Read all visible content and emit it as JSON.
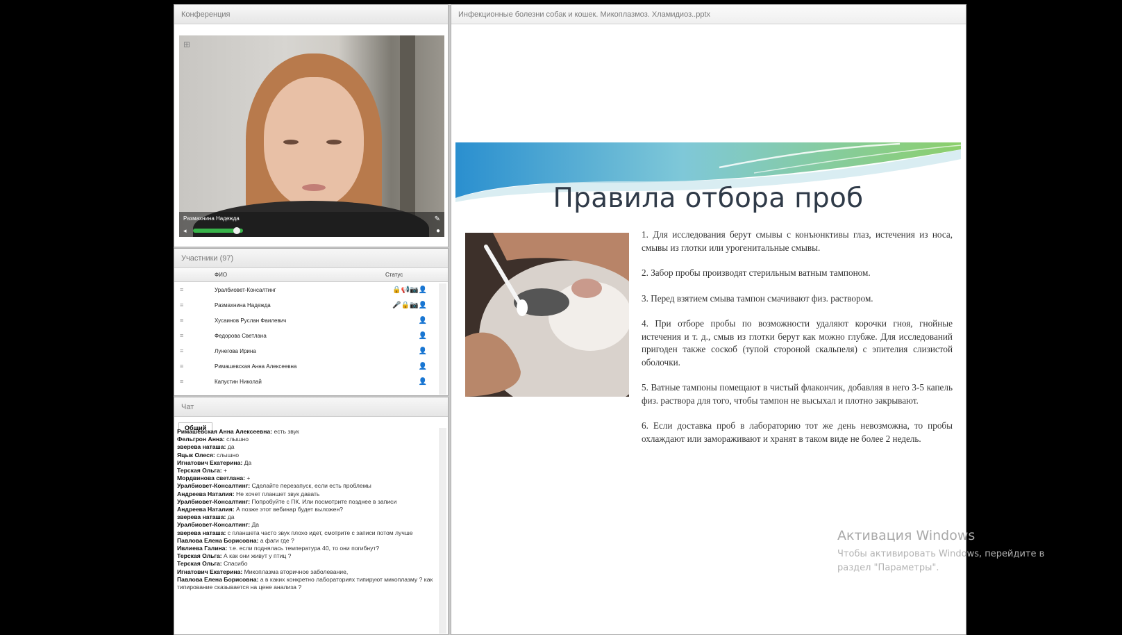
{
  "conference": {
    "title": "Конференция",
    "speaker_name": "Размахнина Надежда"
  },
  "participants": {
    "title": "Участники (97)",
    "col_name": "ФИО",
    "col_status": "Статус",
    "rows": [
      {
        "name": "Уралбиовет-Консалтинг",
        "status": "🔒📢📷👤"
      },
      {
        "name": "Размахнина Надежда",
        "status": "🎤🔒📷👤"
      },
      {
        "name": "Хусаинов Руслан Фаилевич",
        "status": "👤"
      },
      {
        "name": "Федорова Светлана",
        "status": "👤"
      },
      {
        "name": "Лунегова Ирина",
        "status": "👤"
      },
      {
        "name": "Римашевская Анна Алексеевна",
        "status": "👤"
      },
      {
        "name": "Капустин Николай",
        "status": "👤"
      }
    ]
  },
  "chat": {
    "title": "Чат",
    "tab": "Общий",
    "messages": [
      {
        "author": "Римашевская Анна Алексеевна:",
        "text": "есть звук"
      },
      {
        "author": "Фельгрон Анна:",
        "text": "слышно"
      },
      {
        "author": "зверева наташа:",
        "text": "да"
      },
      {
        "author": "Яцык Олеся:",
        "text": "слышно"
      },
      {
        "author": "Игнатович Екатерина:",
        "text": "Да"
      },
      {
        "author": "Терская Ольга:",
        "text": "+"
      },
      {
        "author": "Мордвинова светлана:",
        "text": "+"
      },
      {
        "author": "Уралбиовет-Консалтинг:",
        "text": "Сделайте перезапуск, если есть проблемы"
      },
      {
        "author": "Андреева Наталия:",
        "text": "Не хочет планшет звук давать"
      },
      {
        "author": "Уралбиовет-Консалтинг:",
        "text": "Попробуйте с ПК. Или посмотрите позднее в записи"
      },
      {
        "author": "Андреева Наталия:",
        "text": "А позже этот вебинар будет выложен?"
      },
      {
        "author": "зверева наташа:",
        "text": "да"
      },
      {
        "author": "Уралбиовет-Консалтинг:",
        "text": "Да"
      },
      {
        "author": "зверева наташа:",
        "text": "с планшета часто звук плохо идет, смотрите с записи потом лучше"
      },
      {
        "author": "Павлова Елена Борисовна:",
        "text": "а фаги где ?"
      },
      {
        "author": "Ивлиева Галина:",
        "text": "т.е. если поднялась температура 40, то они погибнут?"
      },
      {
        "author": "Терская Ольга:",
        "text": "А как они живут у птиц ?"
      },
      {
        "author": "Терская Ольга:",
        "text": "Спасибо"
      },
      {
        "author": "Игнатович Екатерина:",
        "text": "Микоплазма вторичное заболевание,"
      },
      {
        "author": "Павлова Елена Борисовна:",
        "text": "а в каких конкретно лабораториях типируют микоплазму ? как типирование сказывается на цене анализа ?"
      }
    ]
  },
  "presentation": {
    "file_title": "Инфекционные болезни собак и кошек. Микоплазмоз. Хламидиоз..pptx",
    "slide_title": "Правила отбора проб",
    "items": [
      "1.   Для исследования берут смывы с конъюнктивы глаз, истечения из носа, смывы из глотки или урогенитальные смывы.",
      "2. Забор пробы производят стерильным ватным тампоном.",
      "3.   Перед взятием смыва тампон смачивают физ. раствором.",
      "4.   При отборе пробы по возможности  удаляют корочки гноя, гнойные истечения и т. д., смыв из глотки берут как можно глубже.  Для исследований пригоден также соскоб (тупой стороной скальпеля) с эпителия слизистой оболочки.",
      "5.     Ватные тампоны помещают в чистый флакончик, добавляя в него 3-5 капель физ. раствора  для того, чтобы тампон не высыхал и плотно закрывают.",
      "6.     Если доставка проб в лабораторию тот же день невозможна, то    пробы охлаждают или замораживают и хранят в таком виде не более 2 недель."
    ]
  },
  "watermark": {
    "line1": "Активация Windows",
    "line2": "Чтобы активировать Windows, перейдите в",
    "line3": "раздел \"Параметры\"."
  }
}
